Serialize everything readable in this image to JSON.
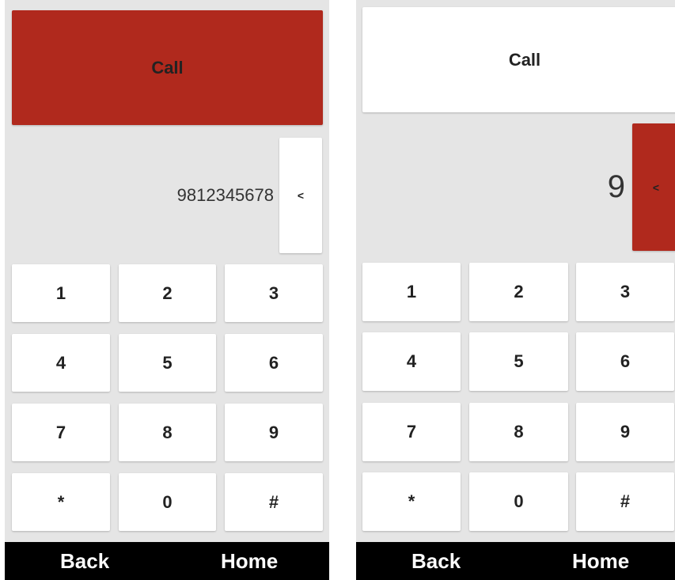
{
  "screens": [
    {
      "call_label": "Call",
      "number_display": "9812345678",
      "backspace_label": "<",
      "keys": [
        "1",
        "2",
        "3",
        "4",
        "5",
        "6",
        "7",
        "8",
        "9",
        "*",
        "0",
        "#"
      ],
      "nav": {
        "back": "Back",
        "home": "Home"
      }
    },
    {
      "call_label": "Call",
      "number_display": "9",
      "backspace_label": "<",
      "keys": [
        "1",
        "2",
        "3",
        "4",
        "5",
        "6",
        "7",
        "8",
        "9",
        "*",
        "0",
        "#"
      ],
      "nav": {
        "back": "Back",
        "home": "Home"
      }
    }
  ],
  "colors": {
    "accent_red": "#b0291d",
    "background": "#e5e5e5",
    "key_bg": "#ffffff",
    "navbar": "#000000"
  }
}
